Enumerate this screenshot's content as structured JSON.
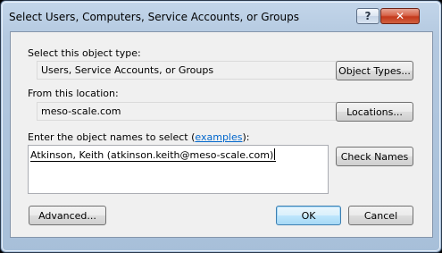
{
  "window": {
    "title": "Select Users, Computers, Service Accounts, or Groups",
    "help_glyph": "?",
    "close_glyph": "✕",
    "accent_close": "#c4391c"
  },
  "object_type": {
    "label": "Select this object type:",
    "value": "Users, Service Accounts, or Groups",
    "button": "Object Types..."
  },
  "location": {
    "label": "From this location:",
    "value": "meso-scale.com",
    "button": "Locations..."
  },
  "names": {
    "label_pre": "Enter the object names to select (",
    "label_link": "examples",
    "label_post": "):",
    "entered_value": "Atkinson, Keith (atkinson.keith@meso-scale.com)",
    "check_button": "Check Names"
  },
  "footer": {
    "advanced_button": "Advanced...",
    "ok_button": "OK",
    "cancel_button": "Cancel"
  }
}
